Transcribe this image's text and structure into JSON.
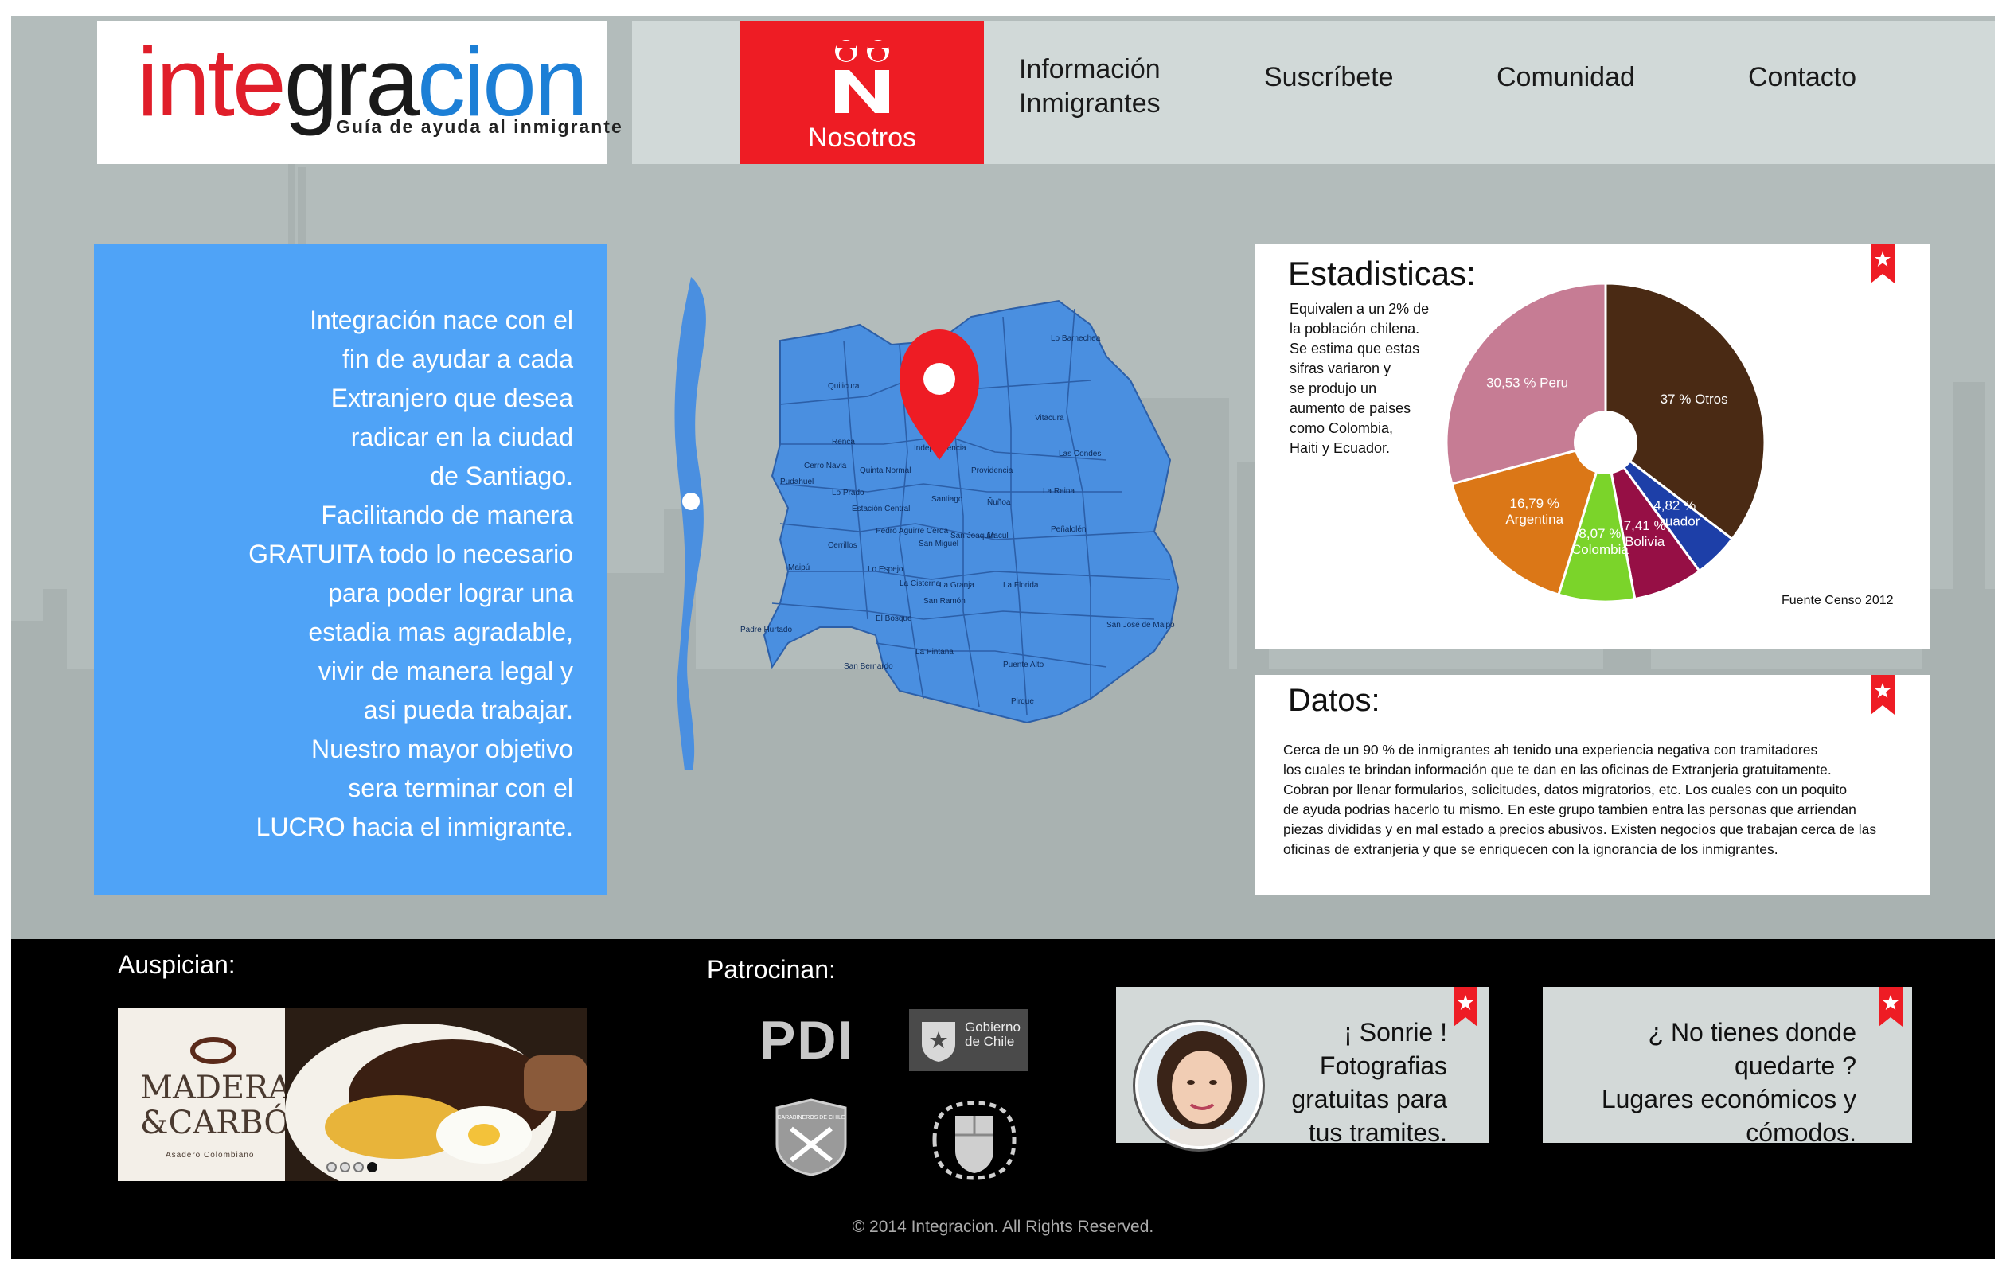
{
  "header": {
    "logo": {
      "text_part1": "inte",
      "text_part2": "gra",
      "text_part3": "cion",
      "tagline": "Guía de ayuda al inmigrante"
    },
    "nav": {
      "nosotros": "Nosotros",
      "informacion": "Información\nInmigrantes",
      "suscribete": "Suscríbete",
      "comunidad": "Comunidad",
      "contacto": "Contacto"
    }
  },
  "intro": {
    "text": "Integración nace con el\nfin de ayudar a cada\nExtranjero que desea\nradicar en la ciudad\nde Santiago.\nFacilitando de manera\nGRATUITA todo lo necesario\npara poder lograr una\nestadia mas agradable,\nvivir de manera legal y\nasi pueda trabajar.\nNuestro mayor objetivo\nsera terminar con el\nLUCRO hacia el inmigrante."
  },
  "map": {
    "communes": [
      "Lo Barnechea",
      "Quilicura",
      "Vitacura",
      "Renca",
      "Independencia",
      "Las Condes",
      "Cerro Navia",
      "Quinta Normal",
      "Providencia",
      "Pudahuel",
      "Lo Prado",
      "Santiago",
      "La Reina",
      "Ñuñoa",
      "Estación Central",
      "Peñalolén",
      "Pedro Aguirre Cerda",
      "San Miguel",
      "San Joaquín",
      "Macul",
      "Cerrillos",
      "Maipú",
      "Lo Espejo",
      "La Cisterna",
      "La Granja",
      "La Florida",
      "El Bosque",
      "San Ramón",
      "Padre Hurtado",
      "San José de Maipo",
      "San Bernardo",
      "La Pintana",
      "Puente Alto",
      "Pirque"
    ]
  },
  "stats": {
    "title": "Estadisticas:",
    "description": "Equivalen a un 2% de\nla población chilena.\nSe estima que estas\nsifras variaron y\nse produjo un\naumento de paises\ncomo Colombia,\nHaiti y Ecuador.",
    "source": "Fuente Censo 2012"
  },
  "chart_data": {
    "type": "pie",
    "title": "Estadisticas:",
    "slices": [
      {
        "label": "Otros",
        "value": 37,
        "display": "37 %  Otros",
        "color": "#4a2a14"
      },
      {
        "label": "Ecuador",
        "value": 4.82,
        "display": "4,82 %\nEcuador",
        "color": "#1d3fa8"
      },
      {
        "label": "Bolivia",
        "value": 7.41,
        "display": "7,41 %\nBolivia",
        "color": "#960f45"
      },
      {
        "label": "Colombia",
        "value": 8.07,
        "display": "8,07 %\nColombia",
        "color": "#7bd42a"
      },
      {
        "label": "Argentina",
        "value": 16.79,
        "display": "16,79 %\nArgentina",
        "color": "#db7717"
      },
      {
        "label": "Peru",
        "value": 30.53,
        "display": "30,53 %  Peru",
        "color": "#c67c94"
      }
    ]
  },
  "datos": {
    "title": "Datos:",
    "text": "Cerca de un 90 % de inmigrantes ah tenido una experiencia negativa con tramitadores\nlos cuales te brindan información que te dan en las oficinas de Extranjeria gratuitamente.\nCobran por llenar formularios, solicitudes, datos migratorios, etc. Los cuales con un poquito\nde ayuda podrias hacerlo tu mismo. En este grupo tambien entra las personas que arriendan\npiezas divididas y en mal estado a precios abusivos. Existen negocios que trabajan cerca de las\noficinas de extranjeria y que se enriquecen con la ignorancia de los inmigrantes."
  },
  "footer": {
    "auspician": "Auspician:",
    "patrocinan": "Patrocinan:",
    "banner": {
      "brand_line1": "MADERA",
      "brand_line2": "&CARBÓN",
      "brand_sub": "Asadero Colombiano",
      "slide_count": 4,
      "active_slide": 4
    },
    "logos": {
      "pdi": "PDI",
      "gobierno": "Gobierno\nde Chile",
      "carabineros": "CARABINEROS DE CHILE"
    },
    "promo_sonrie": "¡ Sonrie !\nFotografias\ngratuitas para\ntus tramites.",
    "promo_lugares": "¿ No tienes donde\nquedarte ?\nLugares económicos y\ncómodos.",
    "copyright": "© 2014 Integracion. All Rights Reserved."
  },
  "colors": {
    "accent_red": "#ee1c24",
    "intro_blue": "#4fa3f7",
    "map_blue": "#4a8fe0",
    "background": "#b3bcbb"
  }
}
